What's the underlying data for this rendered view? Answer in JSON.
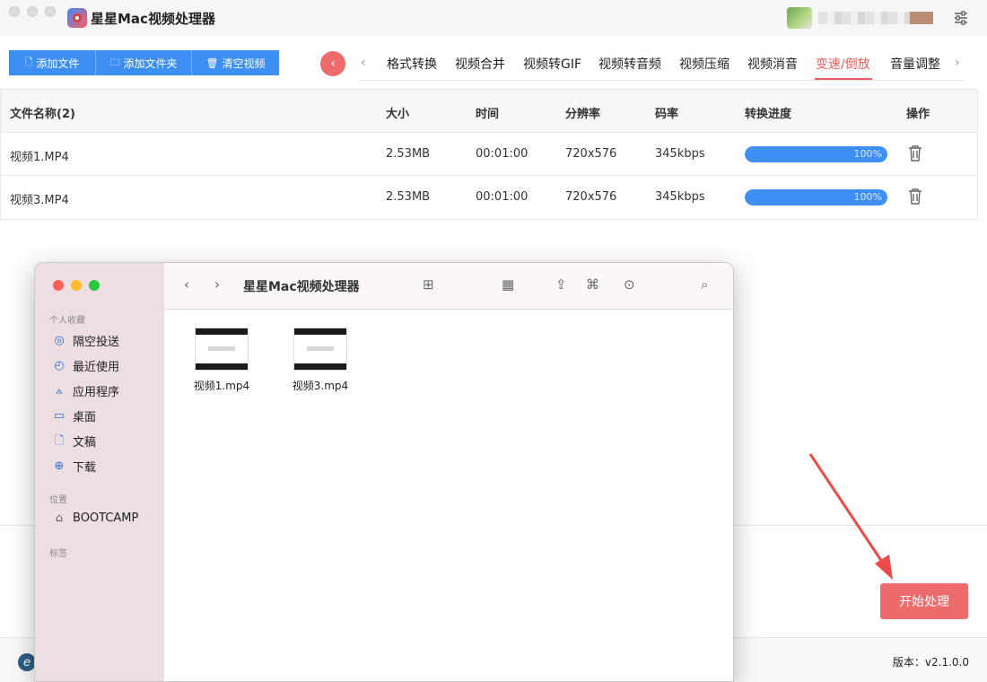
{
  "app": {
    "title": "星星Mac视频处理器"
  },
  "toolbar": {
    "add_file": "添加文件",
    "add_folder": "添加文件夹",
    "clear": "清空视频",
    "back_glyph": "‹"
  },
  "tabs": {
    "prev_glyph": "‹",
    "next_glyph": "›",
    "items": [
      "格式转换",
      "视频合并",
      "视频转GIF",
      "视频转音频",
      "视频压缩",
      "视频消音",
      "变速/倒放",
      "音量调整"
    ],
    "active": "变速/倒放"
  },
  "table": {
    "headers": [
      "文件名称(2)",
      "大小",
      "时间",
      "分辨率",
      "码率",
      "转换进度",
      "操作"
    ],
    "rows": [
      {
        "name": "视频1.MP4",
        "size": "2.53MB",
        "time": "00:01:00",
        "resolution": "720x576",
        "bitrate": "345kbps",
        "progress_text": "100%",
        "progress": 1.0
      },
      {
        "name": "视频3.MP4",
        "size": "2.53MB",
        "time": "00:01:00",
        "resolution": "720x576",
        "bitrate": "345kbps",
        "progress_text": "100%",
        "progress": 1.0
      }
    ]
  },
  "start_button": "开始处理",
  "footer": {
    "version": "版本：v2.1.0.0",
    "edge_glyph": "e"
  },
  "finder": {
    "title": "星星Mac视频处理器",
    "sections": {
      "favorites": "个人收藏",
      "locations": "位置",
      "tags": "标签"
    },
    "favorites": [
      {
        "label": "隔空投送",
        "icon": "airdrop-icon"
      },
      {
        "label": "最近使用",
        "icon": "clock-icon"
      },
      {
        "label": "应用程序",
        "icon": "applications-icon"
      },
      {
        "label": "桌面",
        "icon": "desktop-icon"
      },
      {
        "label": "文稿",
        "icon": "document-icon"
      },
      {
        "label": "下载",
        "icon": "download-icon"
      }
    ],
    "locations": [
      {
        "label": "BOOTCAMP",
        "icon": "drive-icon"
      }
    ],
    "files": [
      {
        "name": "视频1.mp4"
      },
      {
        "name": "视频3.mp4"
      }
    ]
  },
  "colors": {
    "accent_blue": "#3d8ff3",
    "accent_red": "#ee6b6b",
    "active_tab": "#ea5d5d"
  }
}
